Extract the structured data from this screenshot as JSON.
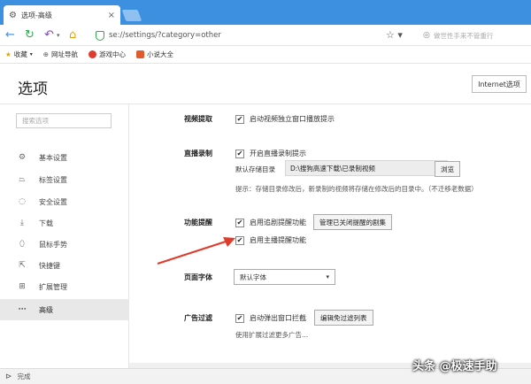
{
  "browser": {
    "tab_title": "选项-高级",
    "address": "se://settings/?category=other",
    "search_placeholder": "做世性手来不管重行"
  },
  "bookmarks": [
    {
      "label": "收藏",
      "icon": "star-icon"
    },
    {
      "label": "网址导航",
      "icon": "globe-icon"
    },
    {
      "label": "游戏中心",
      "icon": "game-icon"
    },
    {
      "label": "小说大全",
      "icon": "book-icon"
    }
  ],
  "header": {
    "title": "选项",
    "ie_button": "Internet选项"
  },
  "sidebar": {
    "search_placeholder": "搜索选项",
    "items": [
      {
        "label": "基本设置",
        "icon": "gear-icon"
      },
      {
        "label": "标签设置",
        "icon": "tab-icon"
      },
      {
        "label": "安全设置",
        "icon": "shield-icon"
      },
      {
        "label": "下载",
        "icon": "download-icon"
      },
      {
        "label": "鼠标手势",
        "icon": "mouse-icon"
      },
      {
        "label": "快捷键",
        "icon": "shortcut-icon"
      },
      {
        "label": "扩展管理",
        "icon": "extension-icon"
      },
      {
        "label": "高级",
        "icon": "more-icon"
      }
    ]
  },
  "video_extract": {
    "title": "视频提取",
    "option": "启动视频独立窗口播放提示",
    "checked": true
  },
  "live_record": {
    "title": "直播录制",
    "option": "开启直播录制提示",
    "checked": true,
    "dir_label": "默认存储目录",
    "dir_value": "D:\\搜狗高速下载\\已录制视频",
    "browse": "浏览",
    "hint": "提示：存储目录修改后，新录制的视频将存储在修改后的目录中。（不迁移老数据）"
  },
  "reminder": {
    "title": "功能提醒",
    "option1": "启用追剧提醒功能",
    "option1_checked": true,
    "manage_button": "管理已关闭提醒的剧集",
    "option2": "启用主播提醒功能",
    "option2_checked": true
  },
  "page_font": {
    "title": "页面字体",
    "value": "默认字体"
  },
  "ad_filter": {
    "title": "广告过滤",
    "option": "启动弹出窗口拦截",
    "checked": true,
    "whitelist_button": "编辑免过滤列表",
    "hint": "使用扩展过滤更多广告..."
  },
  "status": {
    "text": "完成"
  },
  "watermark": "头条 @极速手助",
  "colors": {
    "titlebar": "#3d8fe0",
    "arrow": "#e03c2e",
    "active_nav": "#e8e8e8"
  }
}
